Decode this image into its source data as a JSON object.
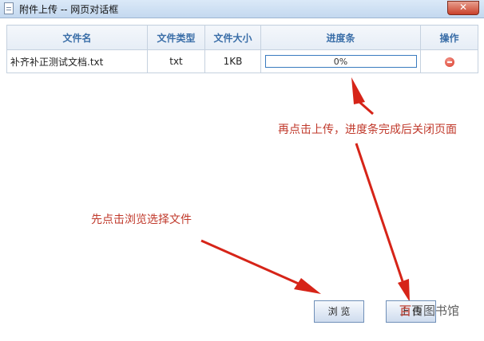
{
  "window": {
    "title": "附件上传 -- 网页对话框",
    "close_label": "✕"
  },
  "table": {
    "headers": [
      "文件名",
      "文件类型",
      "文件大小",
      "进度条",
      "操作"
    ],
    "rows": [
      {
        "name": "补齐补正测试文档.txt",
        "type": "txt",
        "size": "1KB",
        "progress_text": "0%",
        "progress": 0
      }
    ]
  },
  "annotations": {
    "upload_hint": "再点击上传，进度条完成后关闭页面",
    "browse_hint": "先点击浏览选择文件"
  },
  "buttons": {
    "browse_label": "浏 览",
    "upload_label": "上 传"
  },
  "watermark": {
    "logo": "百",
    "text": "百图书馆"
  },
  "colors": {
    "annotation": "#c0392b",
    "header_text": "#3a6ea8",
    "progress_border": "#3a7bbf"
  }
}
